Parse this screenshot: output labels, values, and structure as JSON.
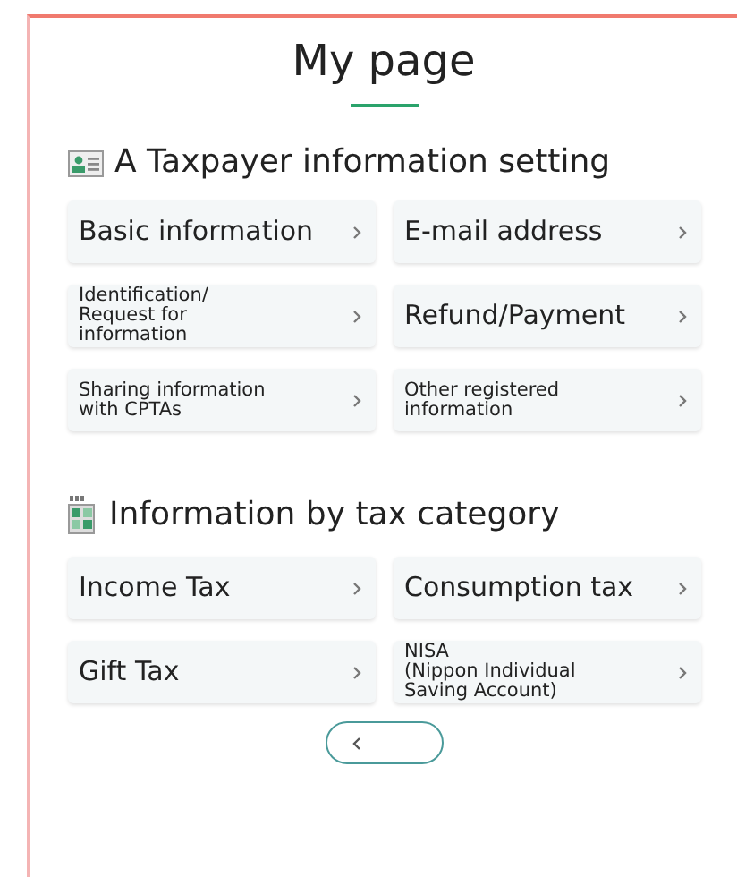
{
  "page_title": "My page",
  "sections": [
    {
      "heading": "A Taxpayer information setting",
      "rows": [
        [
          {
            "label": "Basic information",
            "kind": "regular"
          },
          {
            "label": "E-mail address",
            "kind": "regular"
          }
        ],
        [
          {
            "label": "Identification/\nRequest for\ninformation",
            "kind": "compact"
          },
          {
            "label": "Refund/Payment",
            "kind": "regular"
          }
        ],
        [
          {
            "label": "Sharing information\nwith CPTAs",
            "kind": "compact"
          },
          {
            "label": "Other registered\ninformation",
            "kind": "compact"
          }
        ]
      ]
    },
    {
      "heading": "Information by tax category",
      "rows": [
        [
          {
            "label": "Income Tax",
            "kind": "regular"
          },
          {
            "label": "Consumption tax",
            "kind": "regular"
          }
        ],
        [
          {
            "label": "Gift Tax",
            "kind": "regular"
          },
          {
            "label": "NISA\n(Nippon Individual\nSaving Account)",
            "kind": "compact"
          }
        ]
      ]
    }
  ]
}
